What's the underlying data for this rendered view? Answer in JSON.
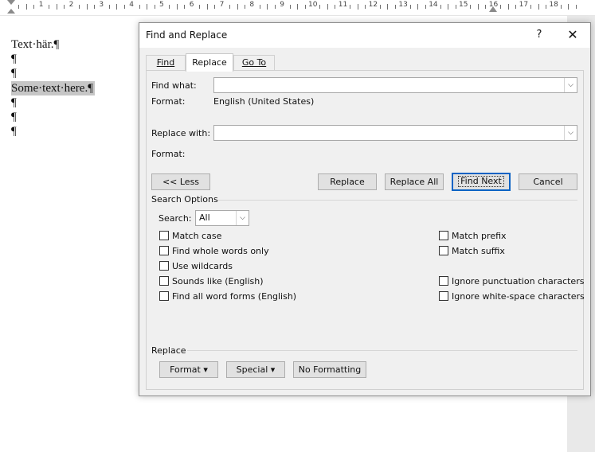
{
  "ruler": {
    "numbers": [
      "1",
      "2",
      "3",
      "4",
      "5",
      "6",
      "7",
      "8",
      "9",
      "10",
      "11",
      "12",
      "13",
      "14",
      "15",
      "16",
      "17",
      "18"
    ]
  },
  "document": {
    "lines": [
      "Text·här.¶",
      "¶",
      "¶",
      "Some·text·here.¶",
      "¶",
      "¶",
      "¶"
    ]
  },
  "dialog": {
    "title": "Find and Replace",
    "help_glyph": "?",
    "close_glyph": "✕",
    "tabs": [
      "Find",
      "Replace",
      "Go To"
    ],
    "find_what_label": "Find what:",
    "find_what_value": "",
    "find_format_label": "Format:",
    "find_format_value": "English (United States)",
    "replace_with_label": "Replace with:",
    "replace_with_value": "",
    "replace_format_label": "Format:",
    "buttons": {
      "less": "<< Less",
      "replace": "Replace",
      "replace_all": "Replace All",
      "find_next": "Find Next",
      "cancel": "Cancel"
    },
    "search_options_label": "Search Options",
    "search_label": "Search:",
    "search_value": "All",
    "options_left": [
      "Match case",
      "Find whole words only",
      "Use wildcards",
      "Sounds like (English)",
      "Find all word forms (English)"
    ],
    "options_right": [
      "Match prefix",
      "Match suffix",
      "Ignore punctuation characters",
      "Ignore white-space characters"
    ],
    "replace_section_label": "Replace",
    "format_button": "Format",
    "special_button": "Special",
    "no_formatting_button": "No Formatting",
    "dropdown_glyph": "▾"
  }
}
